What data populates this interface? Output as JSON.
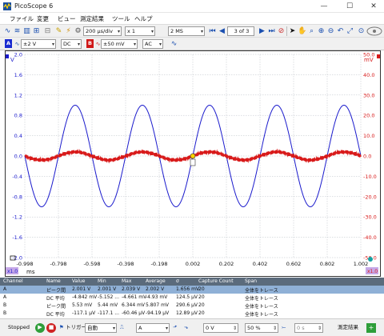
{
  "window": {
    "title": "PicoScope 6"
  },
  "menu": [
    "ファイル",
    "変更",
    "ビュー",
    "測定結果",
    "ツール",
    "ヘルプ"
  ],
  "toolbar": {
    "timebase": "200 µs/div",
    "multiplier": "x 1",
    "samples": "2 MS",
    "capture_counter": "3 of 3"
  },
  "channel_bar": {
    "a_label": "A",
    "a_range": "±2 V",
    "a_coupling": "DC",
    "b_label": "B",
    "b_range": "±50 mV",
    "b_coupling": "AC"
  },
  "colors": {
    "channel_a": "#1a1acc",
    "channel_b": "#d81a1a",
    "grid": "#b9bfc6",
    "table_header": "#5b6b7c",
    "table_row_selected": "#8fb0d6"
  },
  "scope": {
    "left_axis_unit": "V",
    "right_axis_unit": "mV",
    "x_unit": "ms",
    "left_ticks": [
      "2.0",
      "1.6",
      "1.2",
      "0.8",
      "0.4",
      "0.0",
      "-0.4",
      "-0.8",
      "-1.2",
      "-1.6",
      "-2.0"
    ],
    "right_ticks": [
      "50.0",
      "40.0",
      "30.0",
      "20.0",
      "10.0",
      "0.0",
      "-10.0",
      "-20.0",
      "-30.0",
      "-40.0",
      "-50.0"
    ],
    "x_ticks": [
      "-0.998",
      "-0.798",
      "-0.598",
      "-0.398",
      "-0.198",
      "0.002",
      "0.202",
      "0.402",
      "0.602",
      "0.802",
      "1.002"
    ],
    "left_scale_badge": "x1.0",
    "right_scale_badge": "x1.0"
  },
  "chart_data": {
    "type": "line",
    "x_range": [
      -0.998,
      1.002
    ],
    "series": [
      {
        "channel": "A",
        "axis": "left",
        "amplitude": 1.0,
        "period": 0.4,
        "phase_ms": 0.002,
        "ylim": [
          -2.0,
          2.0
        ],
        "noise": 0
      },
      {
        "channel": "B",
        "axis": "right",
        "amplitude": 2.0,
        "period": 0.4,
        "phase_ms": 0.002,
        "ylim": [
          -50.0,
          50.0
        ],
        "noise": 0.9
      }
    ]
  },
  "measurements": {
    "headers": [
      "Channel",
      "Name",
      "Value",
      "Min",
      "Max",
      "Average",
      "σ",
      "Capture Count",
      "Span"
    ],
    "rows": [
      [
        "A",
        "ピーク間",
        "2.001 V",
        "2.001 V",
        "2.039 V",
        "2.002 V",
        "1.656 mV",
        "20",
        "全体をトレース"
      ],
      [
        "A",
        "DC 平均",
        "-4.842 mV",
        "-5.152 ...",
        "-4.661 mV",
        "-4.93 mV",
        "124.5 µV",
        "20",
        "全体をトレース"
      ],
      [
        "B",
        "ピーク間",
        "5.53 mV",
        "5.44 mV",
        "6.344 mV",
        "5.807 mV",
        "290.6 µV",
        "20",
        "全体をトレース"
      ],
      [
        "B",
        "DC 平均",
        "-117.1 µV",
        "-117.1 ...",
        "-60.46 µV",
        "-94.19 µV",
        "12.89 µV",
        "20",
        "全体をトレース"
      ]
    ]
  },
  "bottom": {
    "status": "Stopped",
    "trigger_label": "トリガー",
    "trigger_mode": "自動",
    "trigger_source": "A",
    "trigger_level": "0 V",
    "pretrigger": "50 %",
    "delay": "0 s",
    "measure_label": "測定結果"
  }
}
